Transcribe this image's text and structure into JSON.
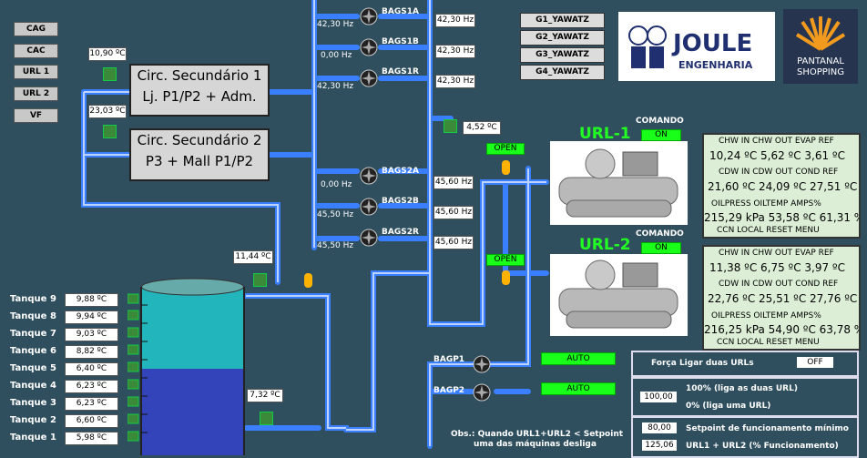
{
  "sidebar": [
    "CAG",
    "CAC",
    "URL 1",
    "URL 2",
    "VF"
  ],
  "g_buttons": [
    "G1_YAWATZ",
    "G2_YAWATZ",
    "G3_YAWATZ",
    "G4_YAWATZ"
  ],
  "logo_joule": {
    "line1": "JOULE",
    "line2": "ENGENHARIA"
  },
  "logo_pantanal": {
    "line1": "PANTANAL",
    "line2": "SHOPPING"
  },
  "circ1": {
    "line1": "Circ. Secundário 1",
    "line2": "Lj. P1/P2 + Adm."
  },
  "circ2": {
    "line1": "Circ. Secundário 2",
    "line2": "P3 + Mall P1/P2"
  },
  "temps": {
    "t1": "10,90 ºC",
    "t2": "23,03 ºC",
    "t3": "4,52 ºC",
    "t4": "11,44 ºC",
    "t5": "7,32 ºC"
  },
  "bags": [
    {
      "name": "BAGS1A",
      "left": "42,30 Hz",
      "right": "42,30 Hz"
    },
    {
      "name": "BAGS1B",
      "left": "0,00 Hz",
      "right": "42,30 Hz"
    },
    {
      "name": "BAGS1R",
      "left": "42,30 Hz",
      "right": "42,30 Hz"
    },
    {
      "name": "BAGS2A",
      "left": "0,00 Hz",
      "right": "45,60 Hz"
    },
    {
      "name": "BAGS2B",
      "left": "45,50 Hz",
      "right": "45,60 Hz"
    },
    {
      "name": "BAGS2R",
      "left": "45,50 Hz",
      "right": "45,60 Hz"
    }
  ],
  "bagp": [
    {
      "name": "BAGP1",
      "status": "AUTO"
    },
    {
      "name": "BAGP2",
      "status": "AUTO"
    }
  ],
  "valves": {
    "v1": "OPEN",
    "v2": "OPEN"
  },
  "url1": {
    "title": "URL-1",
    "cmd_label": "COMANDO",
    "cmd": "ON",
    "rows": [
      "CHW IN  CHW OUT EVAP REF",
      "10,24 ºC  5,62 ºC  3,61 ºC",
      "CDW IN  CDW OUT COND REF",
      "21,60 ºC  24,09 ºC  27,51 ºC",
      "OILPRESS OILTEMP AMPS%",
      "215,29 kPa 53,58 ºC  61,31 %",
      "CCN   LOCAL   RESET   MENU"
    ]
  },
  "url2": {
    "title": "URL-2",
    "cmd_label": "COMANDO",
    "cmd": "ON",
    "rows": [
      "CHW IN  CHW OUT EVAP REF",
      "11,38 ºC  6,75 ºC  3,97 ºC",
      "CDW IN  CDW OUT COND REF",
      "22,76 ºC  25,51 ºC  27,76 ºC",
      "OILPRESS OILTEMP AMPS%",
      "216,25 kPa 54,90 ºC  63,78 %",
      "CCN   LOCAL   RESET   MENU"
    ]
  },
  "tanques": [
    {
      "name": "Tanque 9",
      "value": "9,88 ºC"
    },
    {
      "name": "Tanque 8",
      "value": "9,94 ºC"
    },
    {
      "name": "Tanque 7",
      "value": "9,03 ºC"
    },
    {
      "name": "Tanque 6",
      "value": "8,82 ºC"
    },
    {
      "name": "Tanque 5",
      "value": "6,40 ºC"
    },
    {
      "name": "Tanque 4",
      "value": "6,23 ºC"
    },
    {
      "name": "Tanque 3",
      "value": "6,23 ºC"
    },
    {
      "name": "Tanque 2",
      "value": "6,60 ºC"
    },
    {
      "name": "Tanque 1",
      "value": "5,98 ºC"
    }
  ],
  "controls": {
    "forca_label": "Força Ligar duas URLs",
    "forca_value": "OFF",
    "pct_value": "100,00",
    "pct_line1": "100% (liga as duas URL)",
    "pct_line2": "0% (liga uma URL)",
    "setpoint_value": "80,00",
    "setpoint_label": "Setpoint de funcionamento mínimo",
    "func_value": "125,06",
    "func_label": "URL1 + URL2 (% Funcionamento)"
  },
  "obs": {
    "line1": "Obs.: Quando URL1+URL2 < Setpoint",
    "line2": "uma das máquinas desliga"
  }
}
